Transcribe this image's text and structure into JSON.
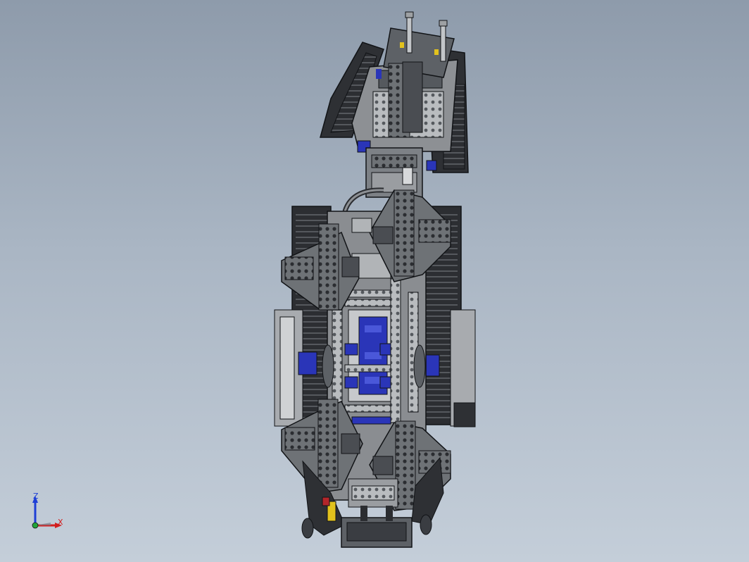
{
  "viewport": {
    "background_top": "#8e9bab",
    "background_bottom": "#c4ced9"
  },
  "model": {
    "icon": "lego-robot-assembly-icon",
    "part_colors": {
      "dark_gray": "#3a3d42",
      "mid_gray": "#6e7276",
      "light_gray": "#b9bcbf",
      "blue": "#2a35b8",
      "yellow": "#e2c21d",
      "red": "#b3262a",
      "edge": "#111316"
    }
  },
  "triad": {
    "z_label": "Z",
    "x_label": "X",
    "z_color": "#1f3fd6",
    "x_color": "#d21f1f"
  }
}
